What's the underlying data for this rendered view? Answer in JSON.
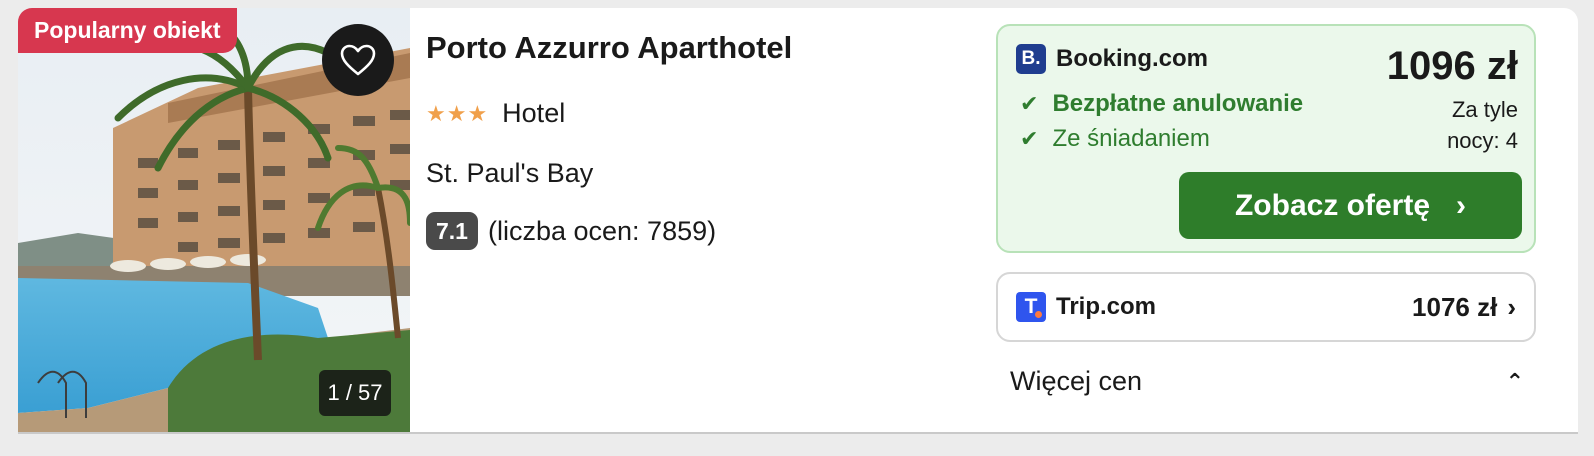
{
  "listing": {
    "badge": "Popularny obiekt",
    "photo_counter": "1 / 57",
    "title": "Porto Azzurro Aparthotel",
    "stars": "★★★",
    "type": "Hotel",
    "location": "St. Paul's Bay",
    "rating": "7.1",
    "rating_count": "(liczba ocen: 7859)"
  },
  "offer_main": {
    "logo_letter": "B.",
    "provider": "Booking.com",
    "features": [
      "Bezpłatne anulowanie",
      "Ze śniadaniem"
    ],
    "check_glyph": "✔",
    "price": "1096 zł",
    "price_note_line1": "Za tyle",
    "price_note_line2": "nocy: 4",
    "cta_label": "Zobacz ofertę",
    "cta_chevron": "›"
  },
  "offer_trip": {
    "logo_letter": "T",
    "provider": "Trip.com",
    "price": "1076 zł",
    "chevron": "›"
  },
  "more_prices": {
    "label": "Więcej cen",
    "chevron": "⌃"
  },
  "colors": {
    "popular_badge": "#d7374f",
    "stars": "#f0a04b",
    "cta": "#2e7d2a",
    "offer_bg": "#ebf8eb",
    "feature_text": "#2f7d2f",
    "booking_logo": "#1f3d8f",
    "trip_logo": "#2f55ee"
  },
  "icons": {
    "favorite": "heart-icon",
    "check": "check-icon",
    "chevron_right": "chevron-right-icon",
    "chevron_up": "chevron-up-icon"
  }
}
